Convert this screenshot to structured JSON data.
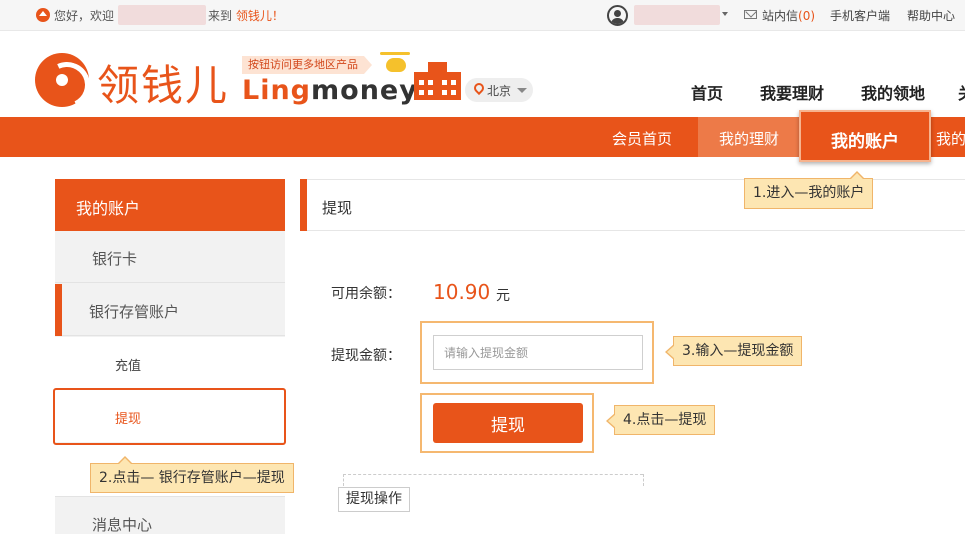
{
  "topbar": {
    "greeting_prefix": "您好，欢迎",
    "greeting_mid": "来到 ",
    "brand": "领钱儿！",
    "inbox_label": "站内信",
    "inbox_count": "(0)",
    "mobile_label": "手机客户端",
    "help_label": "帮助中心"
  },
  "header": {
    "logo_cn": "领钱儿",
    "logo_en_a": "Ling",
    "logo_en_b": "money",
    "promo": "按钮访问更多地区产品",
    "city": "北京",
    "nav": [
      "首页",
      "我要理财",
      "我的领地",
      "关"
    ]
  },
  "subnav": {
    "items": [
      "会员首页",
      "我的理财",
      "我的账户",
      "我的"
    ],
    "active": "我的账户"
  },
  "sidebar": {
    "title": "我的账户",
    "items": [
      "银行卡",
      "银行存管账户"
    ],
    "subitems": [
      "充值",
      "提现"
    ],
    "last": "消息中心"
  },
  "panel": {
    "title": "提现",
    "balance_label": "可用余额：",
    "balance_value": "10.90",
    "balance_unit": "元",
    "amount_label": "提现金额：",
    "amount_placeholder": "请输入提现金额",
    "submit_label": "提现",
    "ops_tab": "提现操作"
  },
  "callouts": {
    "step1": "1.进入—我的账户",
    "step2": "2.点击— 银行存管账户—提现",
    "step3": "3.输入—提现金额",
    "step4": "4.点击—提现"
  },
  "colors": {
    "accent": "#e8541a",
    "callout_bg": "#fde6b2"
  },
  "icons": [
    "home-icon",
    "user-icon",
    "mail-icon",
    "location-pin-icon"
  ]
}
